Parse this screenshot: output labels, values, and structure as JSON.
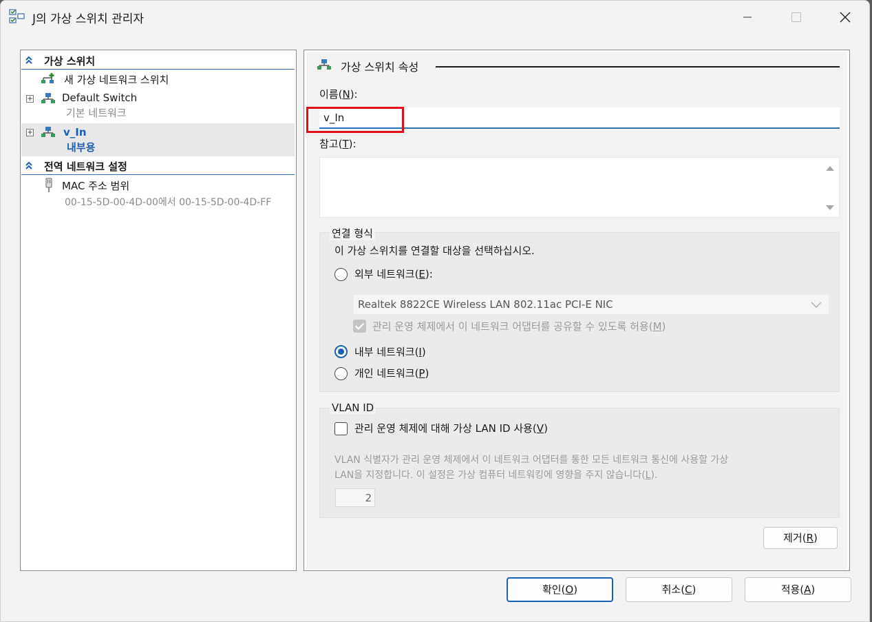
{
  "window": {
    "title": "J의 가상 스위치 관리자",
    "minimize_glyph": "—",
    "maximize_glyph": "☐",
    "close_glyph": "✕"
  },
  "sidebar": {
    "section_virtual_switches": "가상 스위치",
    "new_switch": "새 가상 네트워크 스위치",
    "switches": [
      {
        "name": "Default Switch",
        "type": "기본 네트워크"
      },
      {
        "name": "v_In",
        "type": "내부용"
      }
    ],
    "section_global": "전역 네트워크 설정",
    "mac_range_label": "MAC 주소 범위",
    "mac_range_value": "00-15-5D-00-4D-00에서 00-15-5D-00-4D-FF"
  },
  "properties": {
    "group_title": "가상 스위치 속성",
    "name_label": "이름(N):",
    "name_label_main": "이름(",
    "name_label_key": "N",
    "name_label_end": "):",
    "name_value": "v_In",
    "notes_label_main": "참고(",
    "notes_label_key": "T",
    "notes_label_end": "):",
    "notes_value": ""
  },
  "connection": {
    "legend": "연결 형식",
    "prompt": "이 가상 스위치를 연결할 대상을 선택하십시오.",
    "external_main": "외부 네트워크(",
    "external_key": "E",
    "external_end": "):",
    "adapter": "Realtek 8822CE Wireless LAN 802.11ac PCI-E NIC",
    "allow_share_main": "관리 운영 체제에서 이 네트워크 어댑터를 공유할 수 있도록 허용(",
    "allow_share_key": "M",
    "allow_share_end": ")",
    "internal_main": "내부 네트워크(",
    "internal_key": "I",
    "internal_end": ")",
    "private_main": "개인 네트워크(",
    "private_key": "P",
    "private_end": ")",
    "selected": "internal"
  },
  "vlan": {
    "legend": "VLAN ID",
    "enable_main": "관리 운영 체제에 대해 가상 LAN ID 사용(",
    "enable_key": "V",
    "enable_end": ")",
    "desc_line1": "VLAN 식별자가 관리 운영 체제에서 이 네트워크 어댑터를 통한 모든 네트워크 통신에 사용할 가상",
    "desc_line2_main": "LAN을 지정합니다. 이 설정은 가상 컴퓨터 네트워킹에 영향을 주지 않습니다(",
    "desc_line2_key": "L",
    "desc_line2_end": ").",
    "id_value": "2"
  },
  "buttons": {
    "remove_main": "제거(",
    "remove_key": "R",
    "remove_end": ")",
    "ok_main": "확인(",
    "ok_key": "O",
    "ok_end": ")",
    "cancel_main": "취소(",
    "cancel_key": "C",
    "cancel_end": ")",
    "apply_main": "적용(",
    "apply_key": "A",
    "apply_end": ")"
  },
  "colors": {
    "accent": "#1a5fb4",
    "highlight": "#e0101a"
  }
}
